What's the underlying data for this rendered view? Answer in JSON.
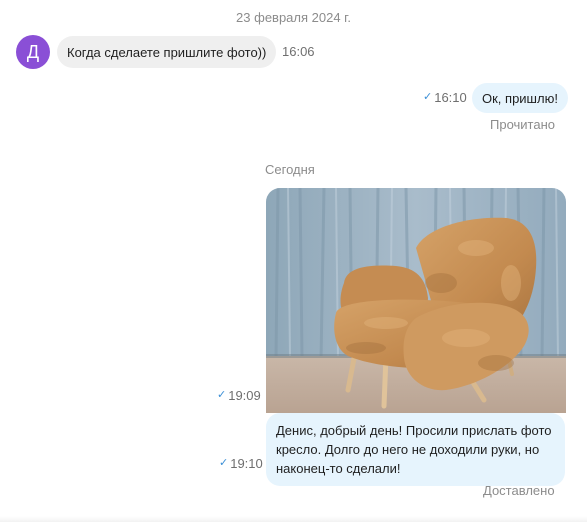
{
  "conversation": {
    "date_separator": "23 февраля 2024 г.",
    "today_separator": "Сегодня",
    "contact": {
      "avatar_letter": "Д",
      "avatar_color": "#8a4fd6"
    },
    "messages": [
      {
        "direction": "incoming",
        "text": "Когда сделаете пришлите фото))",
        "time": "16:06"
      },
      {
        "direction": "outgoing",
        "text": "Ок, пришлю!",
        "time": "16:10",
        "status": "Прочитано"
      },
      {
        "direction": "outgoing",
        "type": "image",
        "image_subject": "mustard-velour-armchair-photo",
        "time": "19:09"
      },
      {
        "direction": "outgoing",
        "text": "Денис, добрый день! Просили прислать фото кресло. Долго до него не доходили руки, но наконец-то сделали!",
        "time": "19:10",
        "status": "Доставлено"
      }
    ]
  },
  "colors": {
    "outgoing_bubble": "#e6f4fd",
    "incoming_bubble": "#efefef",
    "check_mark": "#3b8fd6"
  },
  "icons": {
    "delivered": "check-icon"
  }
}
